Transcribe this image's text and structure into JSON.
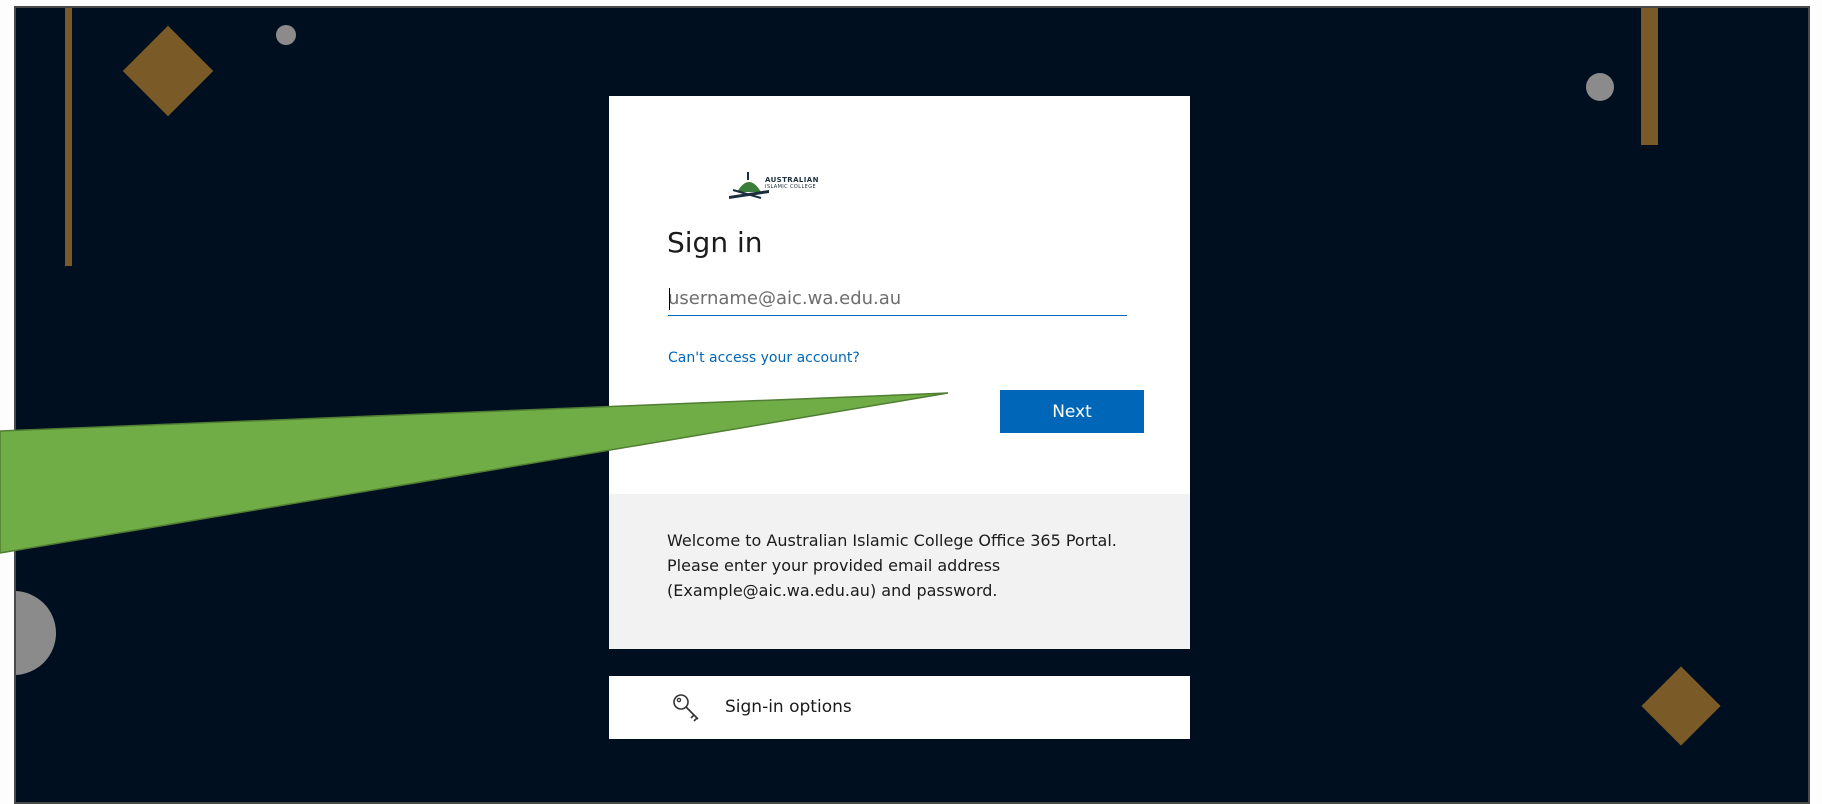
{
  "brand": {
    "logo_line1": "AUSTRALIAN",
    "logo_line2": "ISLAMIC COLLEGE"
  },
  "signin": {
    "title": "Sign in",
    "email_placeholder": "username@aic.wa.edu.au",
    "email_value": "",
    "cant_access_label": "Can't access your account?",
    "next_label": "Next"
  },
  "info": {
    "message": "Welcome to Australian Islamic College Office 365 Portal. Please enter your provided email address (Example@aic.wa.edu.au) and password."
  },
  "signin_options": {
    "icon": "key-icon",
    "label": "Sign-in options"
  },
  "colors": {
    "background": "#000f1f",
    "accent": "#0067b8",
    "decor_gold": "#7a5a26",
    "decor_gray": "#8b8b8b",
    "callout_green": "#70ad47"
  }
}
